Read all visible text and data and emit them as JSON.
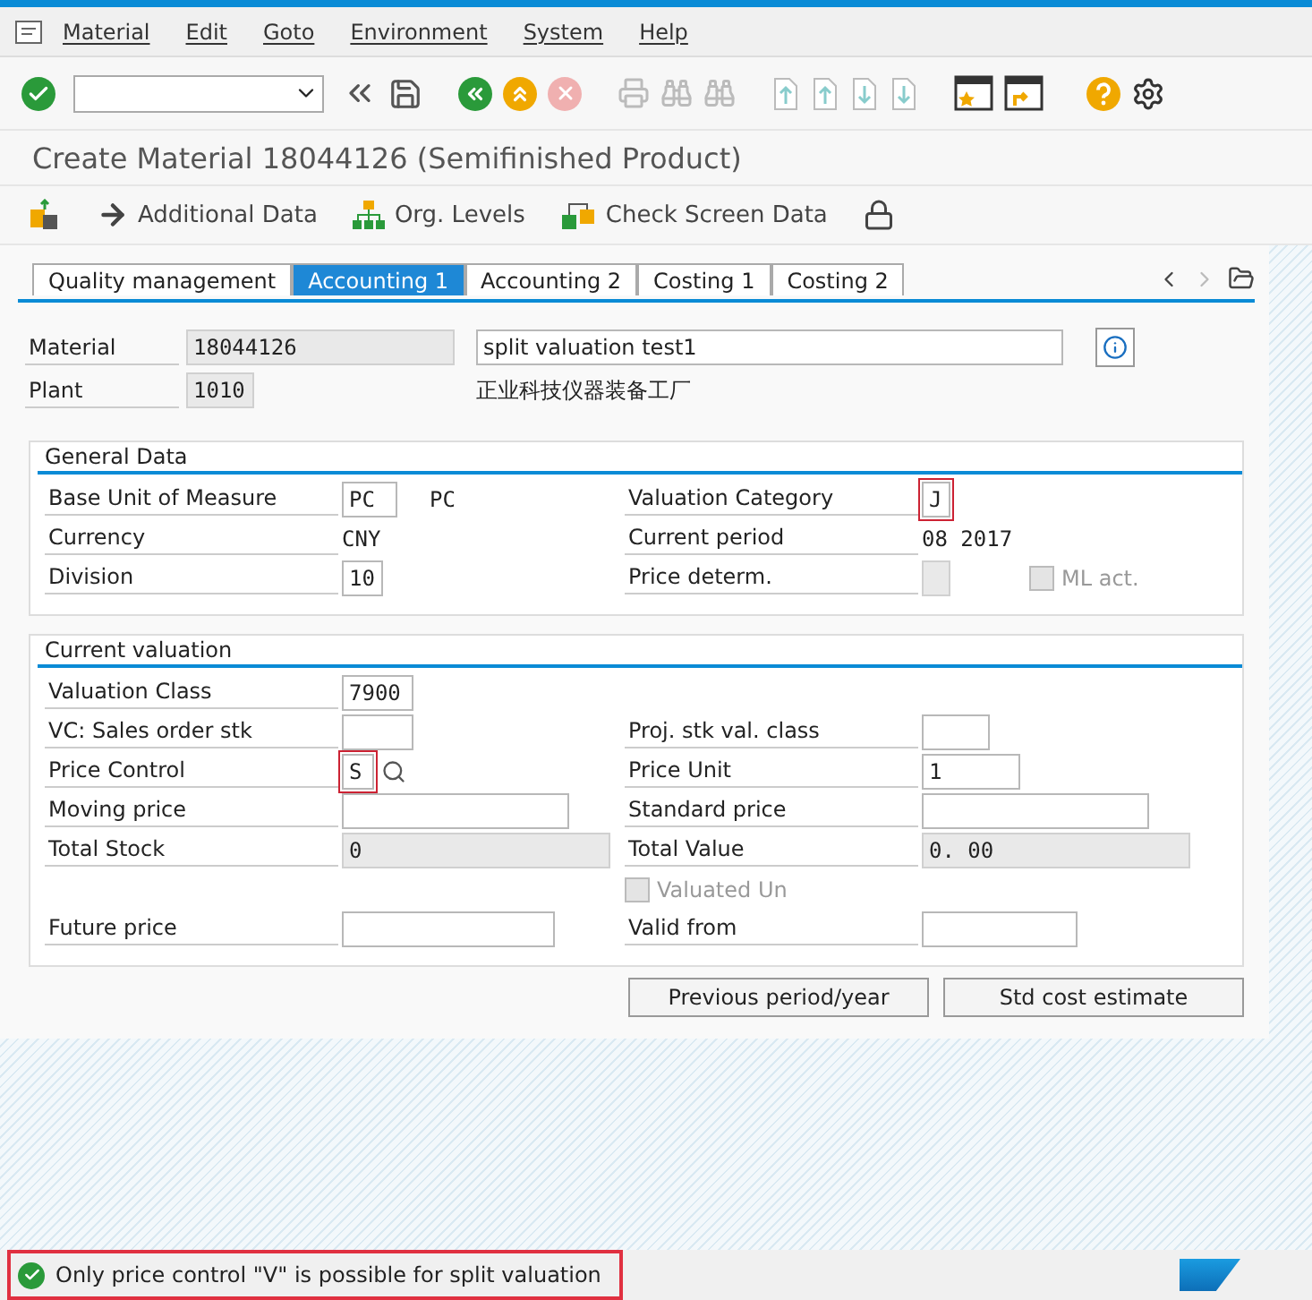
{
  "menu": [
    {
      "label": "Material"
    },
    {
      "label": "Edit"
    },
    {
      "label": "Goto"
    },
    {
      "label": "Environment"
    },
    {
      "label": "System"
    },
    {
      "label": "Help"
    }
  ],
  "title": "Create Material 18044126 (Semifinished Product)",
  "app_toolbar": [
    {
      "kind": "views"
    },
    {
      "kind": "arrow",
      "label": "Additional Data"
    },
    {
      "kind": "org",
      "label": "Org. Levels"
    },
    {
      "kind": "check",
      "label": "Check Screen Data"
    },
    {
      "kind": "lock"
    }
  ],
  "tabs": [
    {
      "label": "Quality management",
      "selected": false
    },
    {
      "label": "Accounting 1",
      "selected": true
    },
    {
      "label": "Accounting 2",
      "selected": false
    },
    {
      "label": "Costing 1",
      "selected": false
    },
    {
      "label": "Costing 2",
      "selected": false
    }
  ],
  "header": {
    "material_label": "Material",
    "material_value": "18044126",
    "description": "split valuation test1",
    "plant_label": "Plant",
    "plant_value": "1010",
    "plant_name": "正业科技仪器装备工厂"
  },
  "sections": [
    {
      "title": "General Data",
      "rows": [
        {
          "left": {
            "label": "Base Unit of Measure",
            "kind": "input",
            "value": "PC",
            "unit": "PC"
          },
          "right": {
            "label": "Valuation Category",
            "kind": "input",
            "value": "J",
            "highlighted": true
          }
        },
        {
          "left": {
            "label": "Currency",
            "kind": "text",
            "value": "CNY"
          },
          "right": {
            "label": "Current period",
            "kind": "text",
            "value": "08 2017"
          }
        },
        {
          "left": {
            "label": "Division",
            "kind": "input",
            "value": "10"
          },
          "right": {
            "label": "Price determ.",
            "kind": "readonly",
            "check": {
              "label": "ML act.",
              "checked": false,
              "disabled": true
            }
          }
        }
      ]
    },
    {
      "title": "Current valuation",
      "rows": [
        {
          "left": {
            "label": "Valuation Class",
            "kind": "input",
            "value": "7900"
          }
        },
        {
          "left": {
            "label": "VC: Sales order stk",
            "kind": "input"
          },
          "right": {
            "label": "Proj. stk val. class",
            "kind": "input"
          }
        },
        {
          "left": {
            "label": "Price Control",
            "kind": "input",
            "value": "S",
            "search": true,
            "highlighted": true
          },
          "right": {
            "label": "Price Unit",
            "kind": "input",
            "value": "1"
          }
        },
        {
          "left": {
            "label": "Moving price",
            "kind": "input"
          },
          "right": {
            "label": "Standard price",
            "kind": "input"
          }
        },
        {
          "left": {
            "label": "Total Stock",
            "kind": "readonly",
            "value": "0"
          },
          "right": {
            "label": "Total Value",
            "kind": "readonly",
            "value": "0. 00"
          }
        },
        {
          "right": {
            "kind": "checkbox",
            "label": "Valuated Un",
            "checked": false,
            "disabled": true
          }
        },
        {
          "left": {
            "label": "Future price",
            "kind": "input"
          },
          "right": {
            "label": "Valid from",
            "kind": "input"
          }
        }
      ]
    }
  ],
  "buttons": [
    {
      "label": "Previous period/year"
    },
    {
      "label": "Std cost estimate"
    }
  ],
  "status": {
    "message": "Only price control \"V\" is possible for split valuation",
    "highlighted": true
  }
}
